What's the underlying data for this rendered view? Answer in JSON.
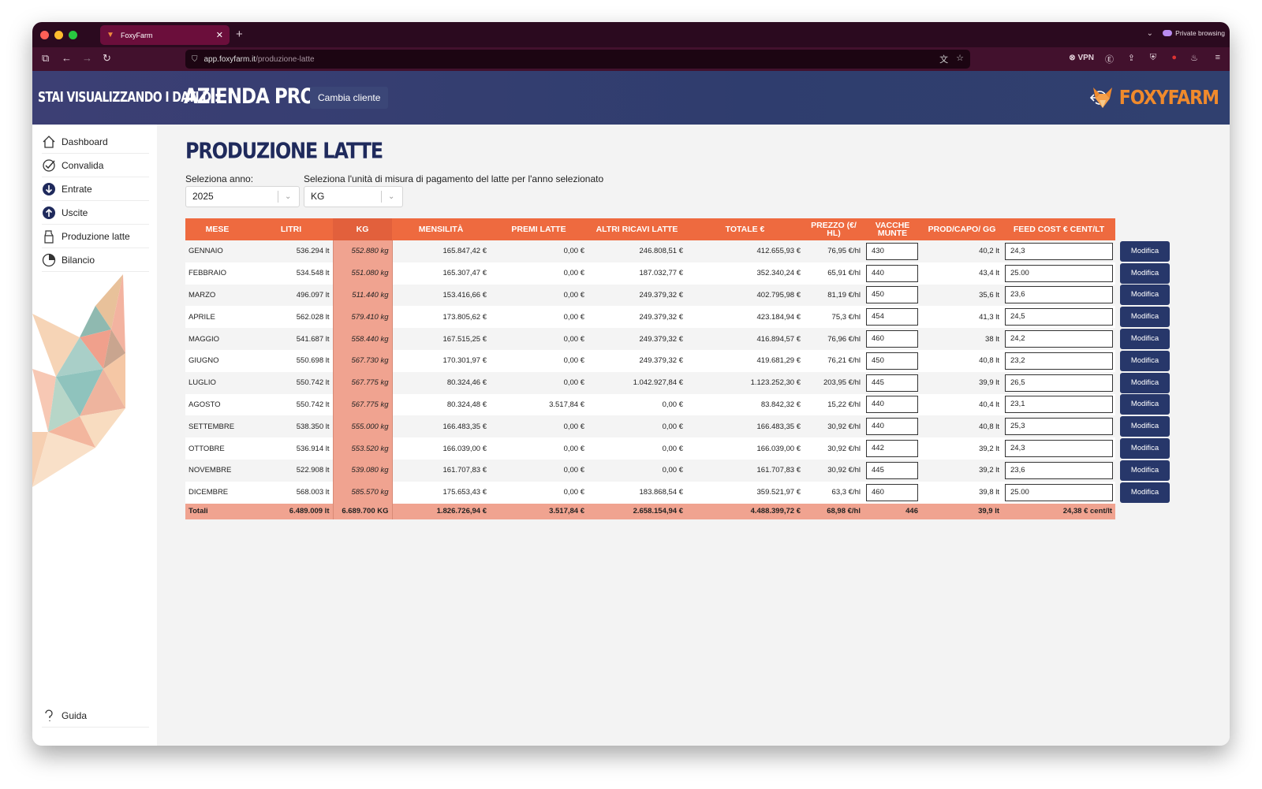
{
  "browser": {
    "tab_title": "FoxyFarm",
    "url_host": "app.foxyfarm.it",
    "url_path": "/produzione-latte",
    "private_label": "Private browsing",
    "vpn_label": "VPN"
  },
  "header": {
    "viewing_label": "STAI VISUALIZZANDO I DATI DI:",
    "company": "AZIENDA PROVA",
    "change_client": "Cambia cliente",
    "logo_text": "FOXYFARM"
  },
  "sidebar": {
    "items": [
      {
        "label": "Dashboard",
        "icon": "home-icon"
      },
      {
        "label": "Convalida",
        "icon": "check-circle-icon"
      },
      {
        "label": "Entrate",
        "icon": "arrow-down-circle-icon"
      },
      {
        "label": "Uscite",
        "icon": "arrow-up-circle-icon"
      },
      {
        "label": "Produzione latte",
        "icon": "milk-carton-icon"
      },
      {
        "label": "Bilancio",
        "icon": "pie-chart-icon"
      }
    ],
    "help": "Guida"
  },
  "main": {
    "title": "PRODUZIONE LATTE",
    "year_label": "Seleziona anno:",
    "year_value": "2025",
    "unit_label": "Seleziona l'unità di misura di pagamento del latte per l'anno selezionato",
    "unit_value": "KG"
  },
  "table": {
    "headers": [
      "MESE",
      "LITRI",
      "KG",
      "MENSILITÀ",
      "PREMI LATTE",
      "ALTRI RICAVI LATTE",
      "TOTALE €",
      "PREZZO (€/ HL)",
      "VACCHE MUNTE",
      "PROD/CAPO/ GG",
      "FEED COST € CENT/LT"
    ],
    "action_label": "Modifica",
    "rows": [
      [
        "GENNAIO",
        "536.294 lt",
        "552.880 kg",
        "165.847,42 €",
        "0,00 €",
        "246.808,51 €",
        "412.655,93 €",
        "76,95 €/hl",
        "430",
        "40,2 lt",
        "24,3"
      ],
      [
        "FEBBRAIO",
        "534.548 lt",
        "551.080 kg",
        "165.307,47 €",
        "0,00 €",
        "187.032,77 €",
        "352.340,24 €",
        "65,91 €/hl",
        "440",
        "43,4 lt",
        "25.00"
      ],
      [
        "MARZO",
        "496.097 lt",
        "511.440 kg",
        "153.416,66 €",
        "0,00 €",
        "249.379,32 €",
        "402.795,98 €",
        "81,19 €/hl",
        "450",
        "35,6 lt",
        "23,6"
      ],
      [
        "APRILE",
        "562.028 lt",
        "579.410 kg",
        "173.805,62 €",
        "0,00 €",
        "249.379,32 €",
        "423.184,94 €",
        "75,3 €/hl",
        "454",
        "41,3 lt",
        "24,5"
      ],
      [
        "MAGGIO",
        "541.687 lt",
        "558.440 kg",
        "167.515,25 €",
        "0,00 €",
        "249.379,32 €",
        "416.894,57 €",
        "76,96 €/hl",
        "460",
        "38 lt",
        "24,2"
      ],
      [
        "GIUGNO",
        "550.698 lt",
        "567.730 kg",
        "170.301,97 €",
        "0,00 €",
        "249.379,32 €",
        "419.681,29 €",
        "76,21 €/hl",
        "450",
        "40,8 lt",
        "23,2"
      ],
      [
        "LUGLIO",
        "550.742 lt",
        "567.775 kg",
        "80.324,46 €",
        "0,00 €",
        "1.042.927,84 €",
        "1.123.252,30 €",
        "203,95 €/hl",
        "445",
        "39,9 lt",
        "26,5"
      ],
      [
        "AGOSTO",
        "550.742 lt",
        "567.775 kg",
        "80.324,48 €",
        "3.517,84 €",
        "0,00 €",
        "83.842,32 €",
        "15,22 €/hl",
        "440",
        "40,4 lt",
        "23,1"
      ],
      [
        "SETTEMBRE",
        "538.350 lt",
        "555.000 kg",
        "166.483,35 €",
        "0,00 €",
        "0,00 €",
        "166.483,35 €",
        "30,92 €/hl",
        "440",
        "40,8 lt",
        "25,3"
      ],
      [
        "OTTOBRE",
        "536.914 lt",
        "553.520 kg",
        "166.039,00 €",
        "0,00 €",
        "0,00 €",
        "166.039,00 €",
        "30,92 €/hl",
        "442",
        "39,2 lt",
        "24,3"
      ],
      [
        "NOVEMBRE",
        "522.908 lt",
        "539.080 kg",
        "161.707,83 €",
        "0,00 €",
        "0,00 €",
        "161.707,83 €",
        "30,92 €/hl",
        "445",
        "39,2 lt",
        "23,6"
      ],
      [
        "DICEMBRE",
        "568.003 lt",
        "585.570 kg",
        "175.653,43 €",
        "0,00 €",
        "183.868,54 €",
        "359.521,97 €",
        "63,3 €/hl",
        "460",
        "39,8 lt",
        "25.00"
      ]
    ],
    "totals": [
      "Totali",
      "6.489.009 lt",
      "6.689.700 KG",
      "1.826.726,94 €",
      "3.517,84 €",
      "2.658.154,94 €",
      "4.488.399,72 €",
      "68,98 €/hl",
      "446",
      "39,9 lt",
      "24,38 € cent/lt"
    ]
  },
  "colors": {
    "header_bg": "#2f3d6e",
    "table_header": "#ee6a3f",
    "kg_column": "#f0a390",
    "button": "#27376a",
    "title": "#1f2a5c",
    "logo": "#f08a2c"
  }
}
